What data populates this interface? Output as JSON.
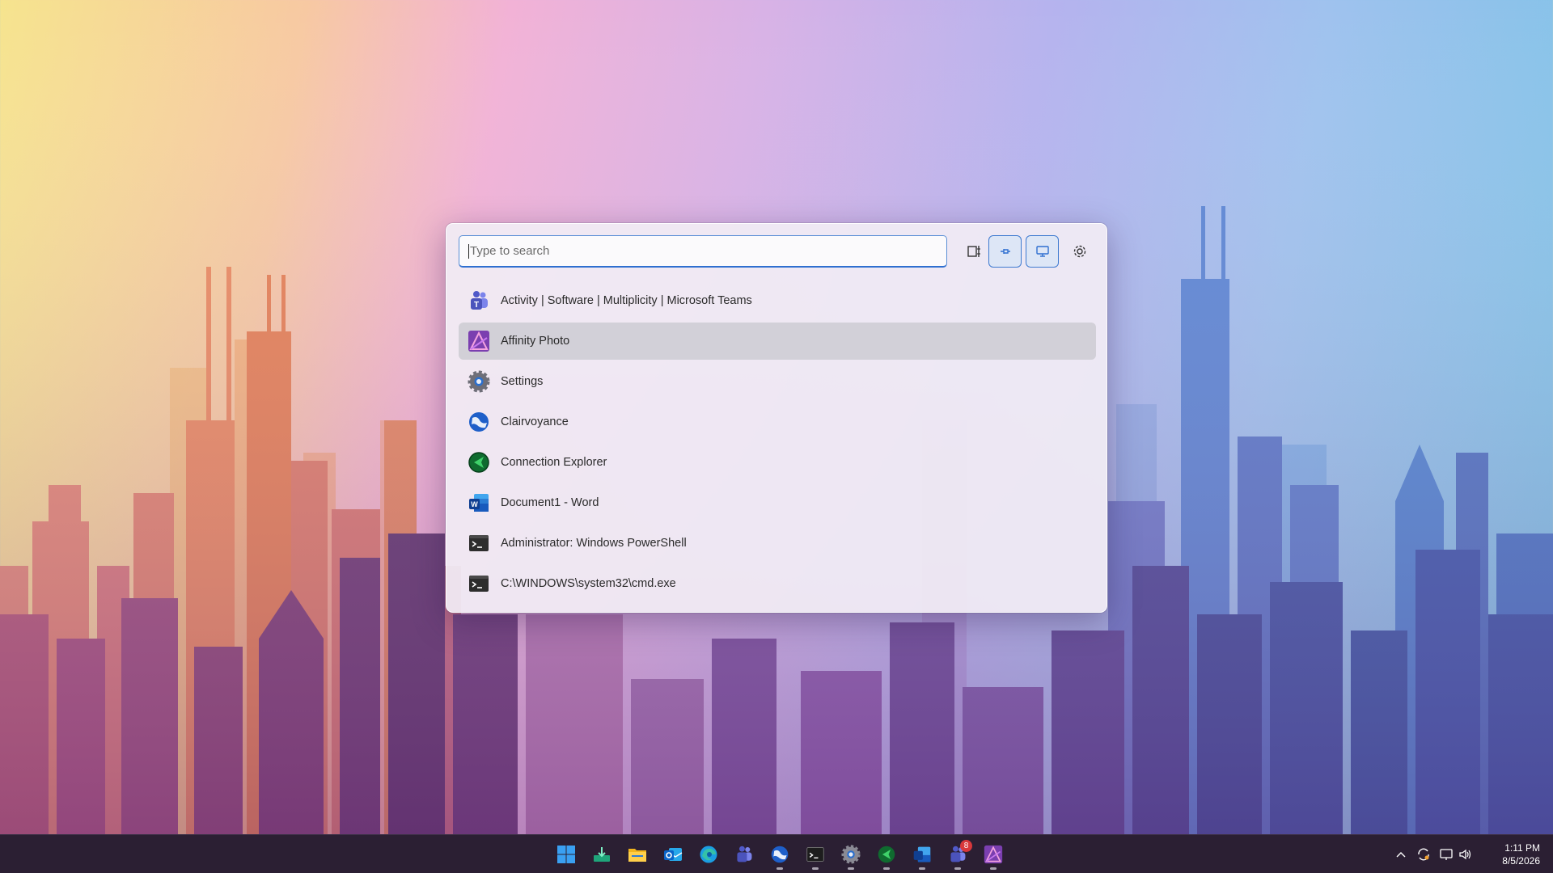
{
  "search": {
    "placeholder": "Type to search"
  },
  "toolbar": {
    "buttons": [
      {
        "name": "window-layout",
        "icon": "window-layout-icon",
        "active": false
      },
      {
        "name": "pin",
        "icon": "pin-icon",
        "active": true
      },
      {
        "name": "monitor",
        "icon": "monitor-icon",
        "active": true
      },
      {
        "name": "settings",
        "icon": "gear-icon",
        "active": false
      }
    ]
  },
  "results": [
    {
      "label": "Activity | Software | Multiplicity | Microsoft Teams",
      "icon": "teams-icon",
      "selected": false
    },
    {
      "label": "Affinity Photo",
      "icon": "affinity-photo-icon",
      "selected": true
    },
    {
      "label": "Settings",
      "icon": "settings-gear-icon",
      "selected": false
    },
    {
      "label": "Clairvoyance",
      "icon": "clairvoyance-globe-icon",
      "selected": false
    },
    {
      "label": "Connection Explorer",
      "icon": "connection-explorer-icon",
      "selected": false
    },
    {
      "label": "Document1 - Word",
      "icon": "word-icon",
      "selected": false
    },
    {
      "label": "Administrator: Windows PowerShell",
      "icon": "terminal-icon",
      "selected": false
    },
    {
      "label": "C:\\WINDOWS\\system32\\cmd.exe",
      "icon": "terminal-icon",
      "selected": false
    }
  ],
  "taskbar": {
    "apps": [
      {
        "name": "start",
        "icon": "windows-start-icon"
      },
      {
        "name": "downloads",
        "icon": "download-tray-icon"
      },
      {
        "name": "file-explorer",
        "icon": "folder-icon"
      },
      {
        "name": "outlook",
        "icon": "outlook-icon"
      },
      {
        "name": "edge",
        "icon": "edge-icon"
      },
      {
        "name": "teams",
        "icon": "teams-icon"
      },
      {
        "name": "clairvoyance",
        "icon": "clairvoyance-globe-icon"
      },
      {
        "name": "terminal",
        "icon": "terminal-icon"
      },
      {
        "name": "settings",
        "icon": "settings-gear-icon"
      },
      {
        "name": "connection-explorer",
        "icon": "connection-explorer-icon"
      },
      {
        "name": "word",
        "icon": "word-icon"
      },
      {
        "name": "teams-badged",
        "icon": "teams-icon",
        "badge": "8"
      },
      {
        "name": "affinity-photo",
        "icon": "affinity-photo-icon"
      }
    ],
    "tray": {
      "icons": [
        "chevron-up-icon",
        "sync-icon",
        "network-icon",
        "volume-icon"
      ],
      "time": "1:11 PM",
      "date": "8/5/2026"
    }
  },
  "colors": {
    "accent": "#2f6fd0",
    "taskbar": "#2b1f33",
    "badge": "#d8383b"
  }
}
